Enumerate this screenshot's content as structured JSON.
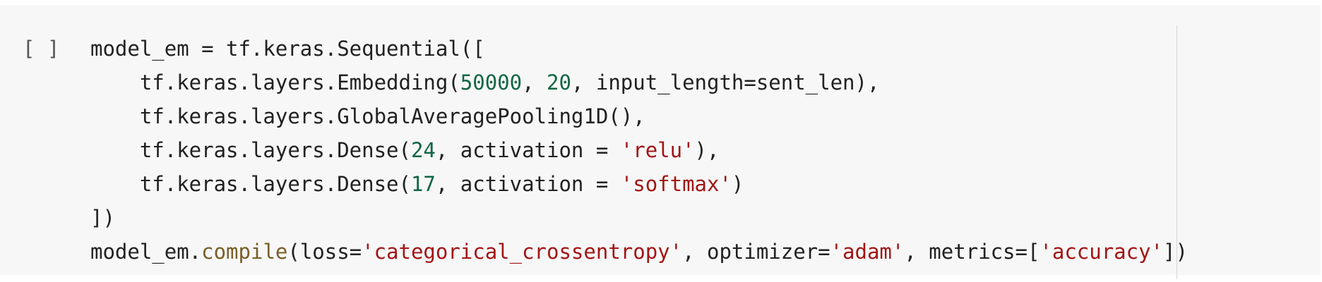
{
  "cell": {
    "run_indicator": "[ ]",
    "code_lines": [
      [
        {
          "t": "model_em = tf.keras.Sequential([",
          "k": "plain"
        }
      ],
      [
        {
          "t": "    tf.keras.layers.Embedding(",
          "k": "plain"
        },
        {
          "t": "50000",
          "k": "num"
        },
        {
          "t": ", ",
          "k": "plain"
        },
        {
          "t": "20",
          "k": "num"
        },
        {
          "t": ", input_length=sent_len),",
          "k": "plain"
        }
      ],
      [
        {
          "t": "    tf.keras.layers.GlobalAveragePooling1D(),",
          "k": "plain"
        }
      ],
      [
        {
          "t": "    tf.keras.layers.Dense(",
          "k": "plain"
        },
        {
          "t": "24",
          "k": "num"
        },
        {
          "t": ", activation = ",
          "k": "plain"
        },
        {
          "t": "'relu'",
          "k": "str"
        },
        {
          "t": "),",
          "k": "plain"
        }
      ],
      [
        {
          "t": "    tf.keras.layers.Dense(",
          "k": "plain"
        },
        {
          "t": "17",
          "k": "num"
        },
        {
          "t": ", activation = ",
          "k": "plain"
        },
        {
          "t": "'softmax'",
          "k": "str"
        },
        {
          "t": ")",
          "k": "plain"
        }
      ],
      [
        {
          "t": "])",
          "k": "plain"
        }
      ],
      [
        {
          "t": "model_em.",
          "k": "plain"
        },
        {
          "t": "compile",
          "k": "fn"
        },
        {
          "t": "(loss=",
          "k": "plain"
        },
        {
          "t": "'categorical_crossentropy'",
          "k": "str"
        },
        {
          "t": ", optimizer=",
          "k": "plain"
        },
        {
          "t": "'adam'",
          "k": "str"
        },
        {
          "t": ", metrics=[",
          "k": "plain"
        },
        {
          "t": "'accuracy'",
          "k": "str"
        },
        {
          "t": "])",
          "k": "plain"
        }
      ]
    ]
  },
  "colors": {
    "background": "#f7f7f7",
    "text": "#212121",
    "number": "#116644",
    "string": "#a31515",
    "function": "#795e26"
  }
}
